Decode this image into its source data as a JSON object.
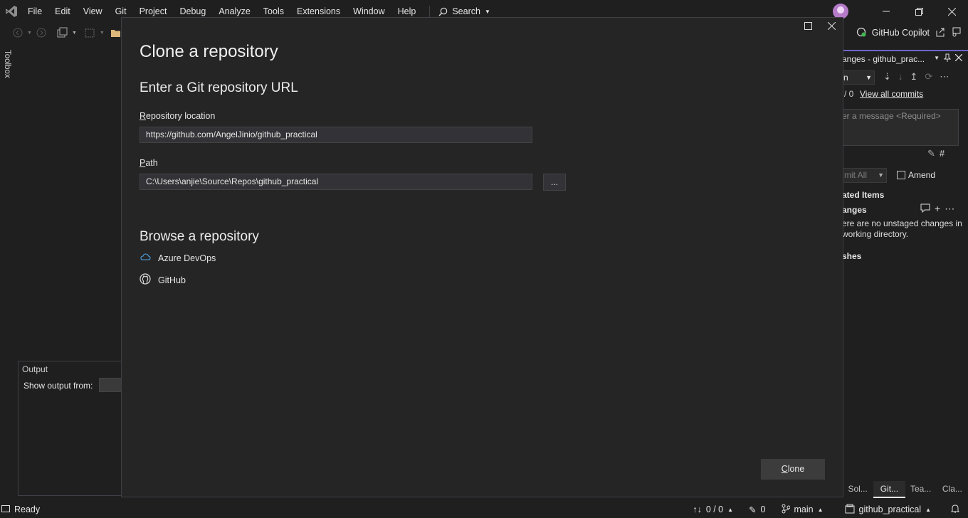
{
  "menubar": {
    "items": [
      "File",
      "Edit",
      "View",
      "Git",
      "Project",
      "Debug",
      "Analyze",
      "Tools",
      "Extensions",
      "Window",
      "Help"
    ],
    "search_label": "Search"
  },
  "toolbar": {
    "copilot_label": "GitHub Copilot"
  },
  "toolbox": {
    "label": "Toolbox"
  },
  "output_panel": {
    "title": "Output",
    "show_output_label": "Show output from:"
  },
  "git_panel": {
    "title": "anges - github_prac...",
    "branch_fragment": "n",
    "commit_count": "/ 0",
    "view_all_commits": "View all commits",
    "message_placeholder": "er a message <Required>",
    "commit_all": "mit All",
    "amend_label": "Amend",
    "related_items": "ated Items",
    "changes_label": "anges",
    "no_changes_text": "ere are no unstaged changes in working directory.",
    "stashes_label": "shes"
  },
  "panel_tabs": [
    "Sol...",
    "Git...",
    "Tea...",
    "Cla..."
  ],
  "statusbar": {
    "ready": "Ready",
    "sync": "0 / 0",
    "edits": "0",
    "branch": "main",
    "repo": "github_practical"
  },
  "dialog": {
    "title": "Clone a repository",
    "url_section": "Enter a Git repository URL",
    "repo_location_label_u": "R",
    "repo_location_label": "epository location",
    "repo_location_value": "https://github.com/AngelJinio/github_practical",
    "path_label_u": "P",
    "path_label": "ath",
    "path_value": "C:\\Users\\anjie\\Source\\Repos\\github_practical",
    "browse_button": "...",
    "browse_section": "Browse a repository",
    "azure_devops": "Azure DevOps",
    "github": "GitHub",
    "clone_button_u": "C",
    "clone_button": "lone"
  },
  "colors": {
    "background": "#1f1f1f",
    "dialog_bg": "#252526",
    "accent": "#6e64c8"
  }
}
